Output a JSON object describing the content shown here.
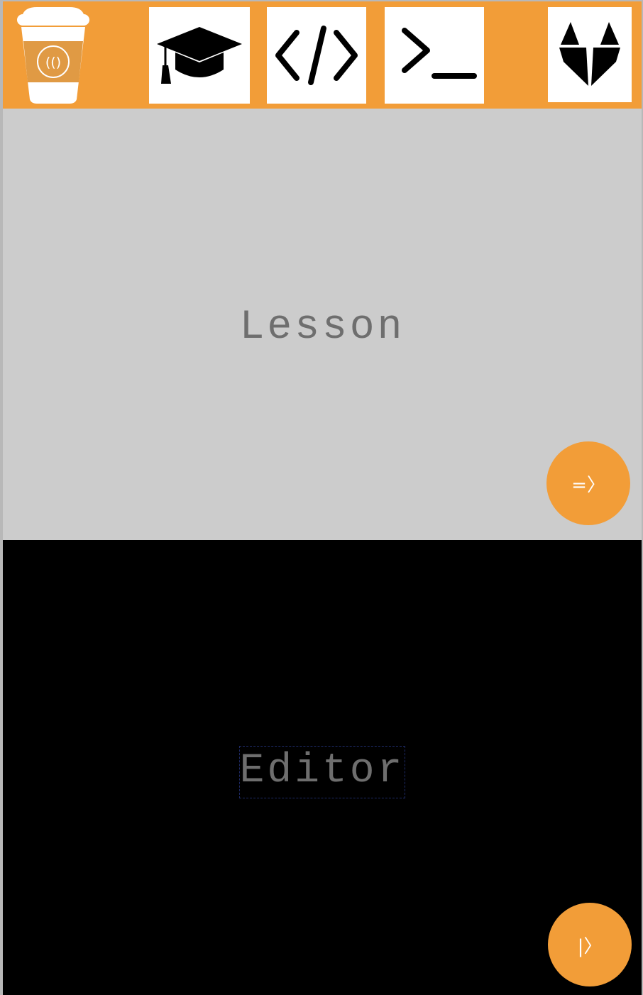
{
  "colors": {
    "toolbar": "#f29d38",
    "cup_sleeve": "#e09a44",
    "lesson_bg": "#cccccc",
    "editor_bg": "#000000",
    "fab": "#f29d38",
    "label_text": "#6e6e6e"
  },
  "toolbar": {
    "logo_icon": "coffee-cup-logo",
    "buttons": [
      {
        "icon": "graduation-cap-icon"
      },
      {
        "icon": "code-brackets-icon"
      },
      {
        "icon": "terminal-prompt-icon"
      },
      {
        "icon": "gitlab-fox-icon"
      }
    ]
  },
  "lesson": {
    "label": "Lesson",
    "fab_label": "=〉",
    "fab_icon": "run-lesson"
  },
  "editor": {
    "label": "Editor",
    "fab_label": "|〉",
    "fab_icon": "run-editor"
  }
}
